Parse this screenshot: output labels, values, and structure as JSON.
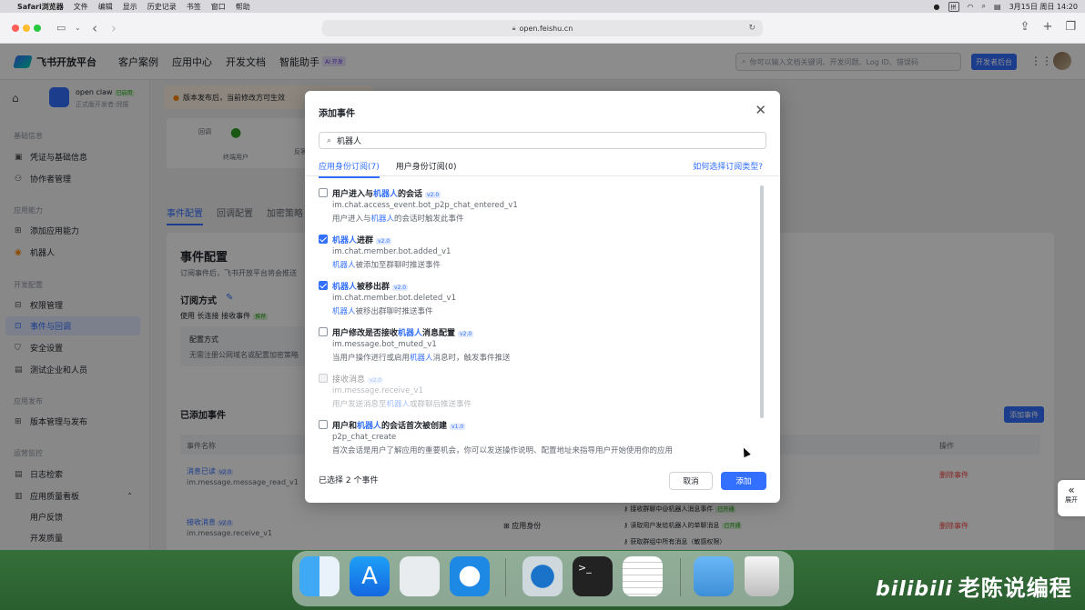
{
  "menubar": {
    "app": "Safari浏览器",
    "items": [
      "文件",
      "编辑",
      "显示",
      "历史记录",
      "书签",
      "窗口",
      "帮助"
    ],
    "keyboard": "拼",
    "datetime": "3月15日 周日  14:20"
  },
  "browser": {
    "url": "open.feishu.cn"
  },
  "topnav": {
    "brand": "飞书开放平台",
    "items": [
      "客户案例",
      "应用中心",
      "开发文档",
      "智能助手"
    ],
    "ai_tag": "AI 开发",
    "search_placeholder": "你可以输入文档关键词、开发问题、Log ID、错误码",
    "dev_console": "开发者后台"
  },
  "sidebar": {
    "app_name": "open claw",
    "app_status": "已启用",
    "app_sub": "正式版开发者:倪振",
    "sections": [
      {
        "title": "基础信息",
        "items": [
          "凭证与基础信息",
          "协作者管理"
        ]
      },
      {
        "title": "应用能力",
        "items": [
          "添加应用能力",
          "机器人"
        ]
      },
      {
        "title": "开发配置",
        "items": [
          "权限管理",
          "事件与回调",
          "安全设置",
          "测试企业和人员"
        ]
      },
      {
        "title": "应用发布",
        "items": [
          "版本管理与发布"
        ]
      },
      {
        "title": "运营监控",
        "items": [
          "日志检索",
          "应用质量看板",
          "用户反馈",
          "开发质量"
        ]
      }
    ]
  },
  "main": {
    "banner": "版本发布后，当前修改方可生效",
    "flow_labels": [
      "回调",
      "终端用户",
      "反客"
    ],
    "tabs": [
      "事件配置",
      "回调配置",
      "加密策略"
    ],
    "panel_title": "事件配置",
    "panel_desc": "订阅事件后，飞书开放平台将会推送",
    "sub_mode_title": "订阅方式",
    "sub_mode_value": "使用 长连接 接收事件",
    "sub_mode_tag": "推荐",
    "config_box_title": "配置方式",
    "config_box_desc": "无需注册公网域名或配置加密策略",
    "added_title": "已添加事件",
    "add_event_btn": "添加事件",
    "table_headers": [
      "事件名称",
      "操作"
    ],
    "rows": [
      {
        "name": "消息已读",
        "ver": "v2.0",
        "key": "im.message.message_read_v1",
        "action": "删除事件"
      },
      {
        "name": "接收消息",
        "ver": "v2.0",
        "key": "im.message.receive_v1",
        "identity": "应用身份",
        "perms": [
          {
            "text": "接收群聊中@机器人消息事件",
            "tag": "已开通"
          },
          {
            "text": "读取用户发给机器人的单聊消息",
            "tag": "已开通"
          },
          {
            "text": "获取群组中所有消息（敏感权限）",
            "tag": ""
          }
        ],
        "action": "删除事件"
      }
    ],
    "expand_label": "展开"
  },
  "modal": {
    "title": "添加事件",
    "search_value": "机器人",
    "tabs": [
      "应用身份订阅(7)",
      "用户身份订阅(0)"
    ],
    "help_link": "如何选择订阅类型?",
    "events": [
      {
        "checked": false,
        "disabled": false,
        "t1": "用户进入与",
        "t2": "机器人",
        "t3": "的会话",
        "ver": "v2.0",
        "key": "im.chat.access_event.bot_p2p_chat_entered_v1",
        "d1": "用户进入与",
        "d2": "机器人",
        "d3": "的会话时触发此事件"
      },
      {
        "checked": true,
        "disabled": false,
        "t1": "",
        "t2": "机器人",
        "t3": "进群",
        "ver": "v2.0",
        "key": "im.chat.member.bot.added_v1",
        "d1": "",
        "d2": "机器人",
        "d3": "被添加至群聊时推送事件"
      },
      {
        "checked": true,
        "disabled": false,
        "t1": "",
        "t2": "机器人",
        "t3": "被移出群",
        "ver": "v2.0",
        "key": "im.chat.member.bot.deleted_v1",
        "d1": "",
        "d2": "机器人",
        "d3": "被移出群聊时推送事件"
      },
      {
        "checked": false,
        "disabled": false,
        "t1": "用户修改是否接收",
        "t2": "机器人",
        "t3": "消息配置",
        "ver": "v2.0",
        "key": "im.message.bot_muted_v1",
        "d1": "当用户操作进行或启用",
        "d2": "机器人",
        "d3": "消息时，触发事件推送"
      },
      {
        "checked": false,
        "disabled": true,
        "t1": "接收消息",
        "t2": "",
        "t3": "",
        "ver": "v2.0",
        "key": "im.message.receive_v1",
        "d1": "用户发送消息至",
        "d2": "机器人",
        "d3": "或群聊后推送事件"
      },
      {
        "checked": false,
        "disabled": false,
        "t1": "用户和",
        "t2": "机器人",
        "t3": "的会话首次被创建",
        "ver": "v1.0",
        "key": "p2p_chat_create",
        "d1": "首次会话是用户了解应用的重要机会，你可以发送操作说明、配置地址来指导用户开始使用你的应用",
        "d2": "",
        "d3": ""
      }
    ],
    "footer": "已选择 2 个事件",
    "cancel": "取消",
    "ok": "添加"
  },
  "watermark": "老陈说编程",
  "watermark_logo": "bilibili"
}
